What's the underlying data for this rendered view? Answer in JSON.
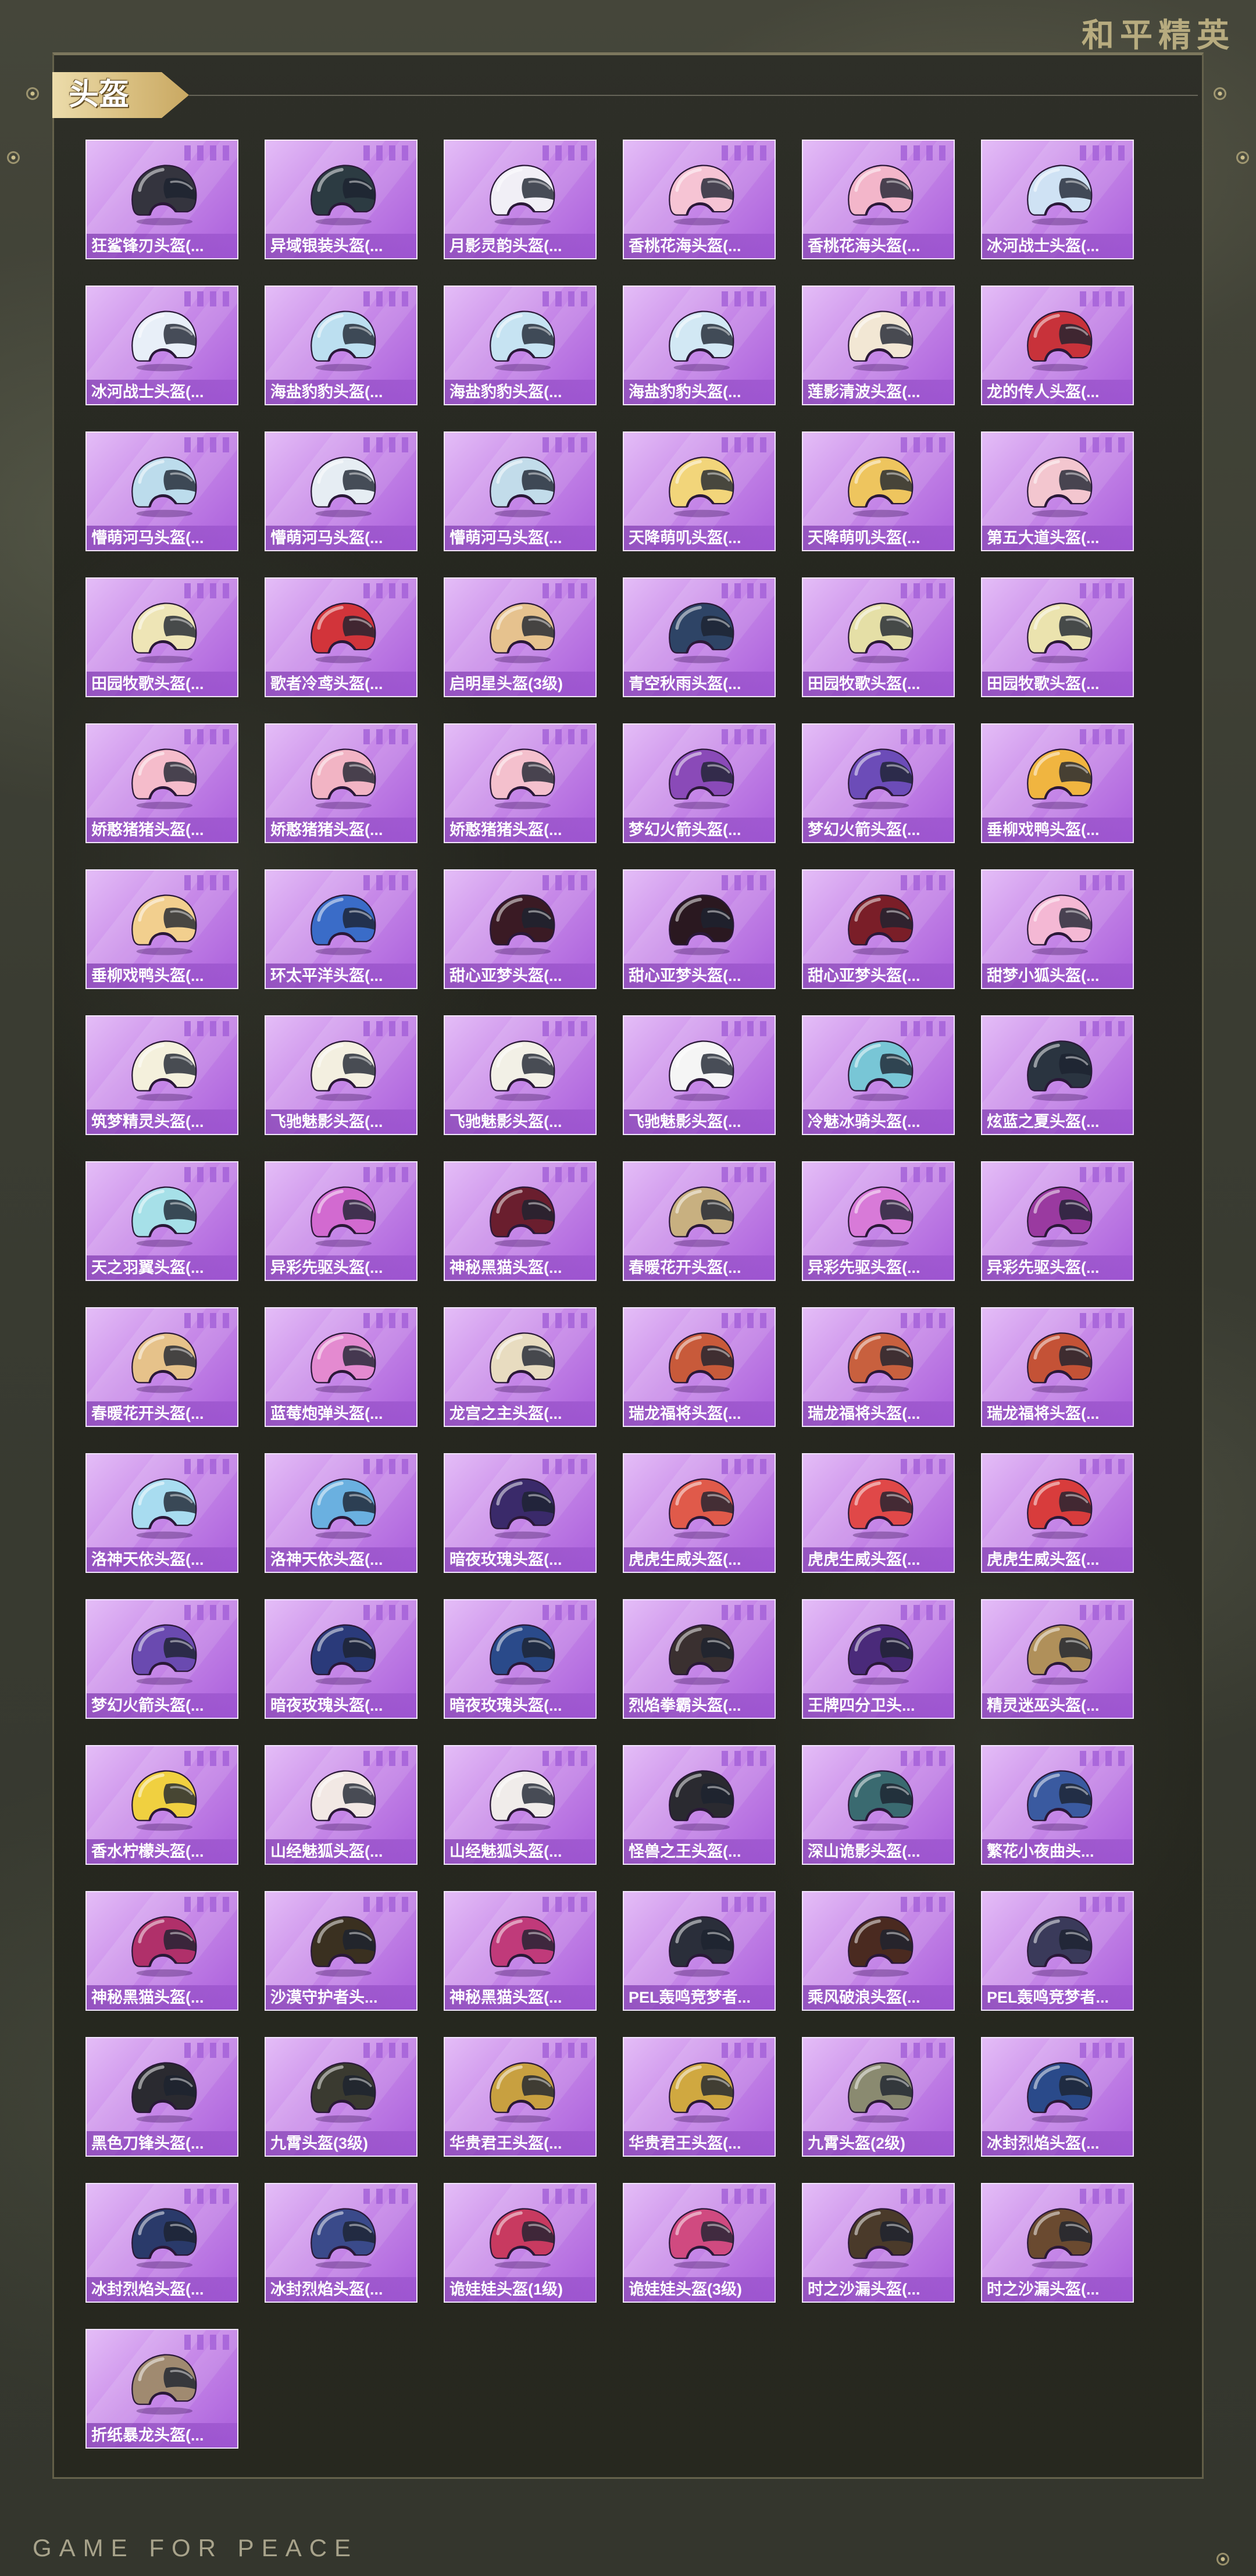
{
  "brand": {
    "logo_text": "和平精英",
    "footer_text": "GAME FOR PEACE"
  },
  "section": {
    "title": "头盔"
  },
  "theme": {
    "accent_gold": "#cbbd8b",
    "tile_purple": "#b370e2",
    "label_text": "#ffffff"
  },
  "items": [
    {
      "name": "狂鲨锋刃头盔(...",
      "color": "#34343e"
    },
    {
      "name": "异域银装头盔(...",
      "color": "#2c3b42"
    },
    {
      "name": "月影灵韵头盔(...",
      "color": "#f1eff6"
    },
    {
      "name": "香桃花海头盔(...",
      "color": "#f6c4d4"
    },
    {
      "name": "香桃花海头盔(...",
      "color": "#f3b6ca"
    },
    {
      "name": "冰河战士头盔(...",
      "color": "#cfe2f4"
    },
    {
      "name": "冰河战士头盔(...",
      "color": "#e8eff8"
    },
    {
      "name": "海盐豹豹头盔(...",
      "color": "#bcdff0"
    },
    {
      "name": "海盐豹豹头盔(...",
      "color": "#c6e3f2"
    },
    {
      "name": "海盐豹豹头盔(...",
      "color": "#d2e8f4"
    },
    {
      "name": "莲影清波头盔(...",
      "color": "#f2e7d4"
    },
    {
      "name": "龙的传人头盔(...",
      "color": "#c8323a"
    },
    {
      "name": "懵萌河马头盔(...",
      "color": "#bcdcec"
    },
    {
      "name": "懵萌河马头盔(...",
      "color": "#e6edf3"
    },
    {
      "name": "懵萌河马头盔(...",
      "color": "#c2dcea"
    },
    {
      "name": "天降萌叽头盔(...",
      "color": "#f2d57a"
    },
    {
      "name": "天降萌叽头盔(...",
      "color": "#eec55e"
    },
    {
      "name": "第五大道头盔(...",
      "color": "#f3c6cf"
    },
    {
      "name": "田园牧歌头盔(...",
      "color": "#eee5b6"
    },
    {
      "name": "歌者冷鸢头盔(...",
      "color": "#d2343a"
    },
    {
      "name": "启明星头盔(3级)",
      "color": "#e6c28e"
    },
    {
      "name": "青空秋雨头盔(...",
      "color": "#2e4466"
    },
    {
      "name": "田园牧歌头盔(...",
      "color": "#e5dfa6"
    },
    {
      "name": "田园牧歌头盔(...",
      "color": "#ebe3ae"
    },
    {
      "name": "娇憨猪猪头盔(...",
      "color": "#f5bccb"
    },
    {
      "name": "娇憨猪猪头盔(...",
      "color": "#f2b4c4"
    },
    {
      "name": "娇憨猪猪头盔(...",
      "color": "#f4c0cd"
    },
    {
      "name": "梦幻火箭头盔(...",
      "color": "#8a4ab8"
    },
    {
      "name": "梦幻火箭头盔(...",
      "color": "#6c4cb8"
    },
    {
      "name": "垂柳戏鸭头盔(...",
      "color": "#f0b540"
    },
    {
      "name": "垂柳戏鸭头盔(...",
      "color": "#f2cf8e"
    },
    {
      "name": "环太平洋头盔(...",
      "color": "#3a6cc8"
    },
    {
      "name": "甜心亚梦头盔(...",
      "color": "#3a1a24"
    },
    {
      "name": "甜心亚梦头盔(...",
      "color": "#2a1820"
    },
    {
      "name": "甜心亚梦头盔(...",
      "color": "#7a1e28"
    },
    {
      "name": "甜梦小狐头盔(...",
      "color": "#f4b8d4"
    },
    {
      "name": "筑梦精灵头盔(...",
      "color": "#f4f0dc"
    },
    {
      "name": "飞驰魅影头盔(...",
      "color": "#f3efe0"
    },
    {
      "name": "飞驰魅影头盔(...",
      "color": "#f2f0e6"
    },
    {
      "name": "飞驰魅影头盔(...",
      "color": "#f5f5f5"
    },
    {
      "name": "冷魅冰骑头盔(...",
      "color": "#78c6d6"
    },
    {
      "name": "炫蓝之夏头盔(...",
      "color": "#2a3440"
    },
    {
      "name": "天之羽翼头盔(...",
      "color": "#a6e0e8"
    },
    {
      "name": "异彩先驱头盔(...",
      "color": "#d26ad0"
    },
    {
      "name": "神秘黑猫头盔(...",
      "color": "#6a1e2e"
    },
    {
      "name": "春暖花开头盔(...",
      "color": "#c8b080"
    },
    {
      "name": "异彩先驱头盔(...",
      "color": "#d87ad8"
    },
    {
      "name": "异彩先驱头盔(...",
      "color": "#9a3aa0"
    },
    {
      "name": "春暖花开头盔(...",
      "color": "#e6c28a"
    },
    {
      "name": "蓝莓炮弹头盔(...",
      "color": "#e48ad0"
    },
    {
      "name": "龙宫之主头盔(...",
      "color": "#e8dcc0"
    },
    {
      "name": "瑞龙福将头盔(...",
      "color": "#c85a3a"
    },
    {
      "name": "瑞龙福将头盔(...",
      "color": "#c8603e"
    },
    {
      "name": "瑞龙福将头盔(...",
      "color": "#c45236"
    },
    {
      "name": "洛神天依头盔(...",
      "color": "#a8dcf0"
    },
    {
      "name": "洛神天依头盔(...",
      "color": "#6ab0e0"
    },
    {
      "name": "暗夜玫瑰头盔(...",
      "color": "#3a2a6a"
    },
    {
      "name": "虎虎生威头盔(...",
      "color": "#e05a4a"
    },
    {
      "name": "虎虎生威头盔(...",
      "color": "#e04848"
    },
    {
      "name": "虎虎生威头盔(...",
      "color": "#d83c3c"
    },
    {
      "name": "梦幻火箭头盔(...",
      "color": "#6a4ab0"
    },
    {
      "name": "暗夜玫瑰头盔(...",
      "color": "#2a3a7a"
    },
    {
      "name": "暗夜玫瑰头盔(...",
      "color": "#2a4a8a"
    },
    {
      "name": "烈焰拳霸头盔(...",
      "color": "#3a3030"
    },
    {
      "name": "王牌四分卫头...",
      "color": "#4a2a7a"
    },
    {
      "name": "精灵迷巫头盔(...",
      "color": "#b0905a"
    },
    {
      "name": "香水柠檬头盔(...",
      "color": "#f0d040"
    },
    {
      "name": "山经魅狐头盔(...",
      "color": "#f2e8e4"
    },
    {
      "name": "山经魅狐头盔(...",
      "color": "#f0ecea"
    },
    {
      "name": "怪兽之王头盔(...",
      "color": "#2a2a30"
    },
    {
      "name": "深山诡影头盔(...",
      "color": "#3a6a70"
    },
    {
      "name": "繁花小夜曲头...",
      "color": "#3a5aa0"
    },
    {
      "name": "神秘黑猫头盔(...",
      "color": "#b0306a"
    },
    {
      "name": "沙漠守护者头...",
      "color": "#3a3020"
    },
    {
      "name": "神秘黑猫头盔(...",
      "color": "#c03a7a"
    },
    {
      "name": "PEL轰鸣竞梦者...",
      "color": "#2a2e3a"
    },
    {
      "name": "乘风破浪头盔(...",
      "color": "#4a2a20"
    },
    {
      "name": "PEL轰鸣竞梦者...",
      "color": "#3a3a5a"
    },
    {
      "name": "黑色刀锋头盔(...",
      "color": "#2a2a30"
    },
    {
      "name": "九霄头盔(3级)",
      "color": "#3a3a30"
    },
    {
      "name": "华贵君王头盔(...",
      "color": "#c8a040"
    },
    {
      "name": "华贵君王头盔(...",
      "color": "#d0a840"
    },
    {
      "name": "九霄头盔(2级)",
      "color": "#8a8a70"
    },
    {
      "name": "冰封烈焰头盔(...",
      "color": "#2a4a8a"
    },
    {
      "name": "冰封烈焰头盔(...",
      "color": "#2a3a6a"
    },
    {
      "name": "冰封烈焰头盔(...",
      "color": "#3a4a8a"
    },
    {
      "name": "诡娃娃头盔(1级)",
      "color": "#c83a60"
    },
    {
      "name": "诡娃娃头盔(3级)",
      "color": "#d04a80"
    },
    {
      "name": "时之沙漏头盔(...",
      "color": "#4a3a2a"
    },
    {
      "name": "时之沙漏头盔(...",
      "color": "#6a4a30"
    },
    {
      "name": "折纸暴龙头盔(...",
      "color": "#a08a70"
    }
  ]
}
